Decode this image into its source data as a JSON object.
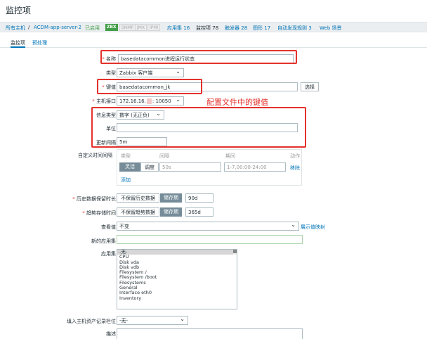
{
  "page": {
    "title": "监控项"
  },
  "subnav": {
    "all_hosts": "所有主机",
    "separator": "/",
    "host": "ACDM-app-server-2",
    "status": "已启用",
    "badges": [
      "ZBX",
      "SNMP",
      "JMX",
      "IPMI"
    ],
    "links": [
      {
        "label": "应用集",
        "count": "16"
      },
      {
        "label": "监控项",
        "count": "78"
      },
      {
        "label": "触发器",
        "count": "28"
      },
      {
        "label": "图形",
        "count": "17"
      },
      {
        "label": "自动发现规则",
        "count": "3"
      },
      {
        "label": "Web 场景",
        "count": ""
      }
    ]
  },
  "tabs": [
    "监控项",
    "预处理"
  ],
  "form": {
    "name": {
      "label": "名称",
      "value": "basedatacommon进程运行状态"
    },
    "type": {
      "label": "类型",
      "value": "Zabbix 客户端"
    },
    "key": {
      "label": "键值",
      "value": "basedatacommon_jk",
      "select_label": "选择"
    },
    "interface": {
      "label": "主机接口",
      "ip": "172.16.16.",
      "port": ": 10050"
    },
    "value_type": {
      "label": "信息类型",
      "value": "数字 (无正负)"
    },
    "units": {
      "label": "单位",
      "value": ""
    },
    "delay": {
      "label": "更新间隔",
      "value": "5m"
    },
    "custom_intervals": {
      "label": "自定义时间间隔",
      "headers": [
        "类型",
        "间隔",
        "期间",
        "动作"
      ],
      "row": {
        "flexible": "灵活",
        "scheduling": "调度",
        "interval": "50s",
        "period": "1-7,00:00-24:00",
        "remove": "移除"
      },
      "add": "添加"
    },
    "history": {
      "label": "历史数据保留时长",
      "opt_off": "不保留历史数据",
      "opt_on": "储存期",
      "value": "90d"
    },
    "trends": {
      "label": "趋势存储时间",
      "opt_off": "不保留趋势数据",
      "opt_on": "储存期",
      "value": "365d"
    },
    "valuemap": {
      "label": "查看值",
      "value": "不变",
      "link": "展示值映射"
    },
    "new_app": {
      "label": "新的应用集",
      "value": ""
    },
    "applications": {
      "label": "应用集",
      "items": [
        "-无-",
        "CPU",
        "Disk vda",
        "Disk vdb",
        "Filesystem /",
        "Filesystem /boot",
        "Filesystems",
        "General",
        "Interface eth0",
        "Inventory"
      ]
    },
    "inventory": {
      "label": "填入主机资产记录栏位",
      "value": "-无-"
    },
    "description": {
      "label": "描述",
      "value": ""
    }
  },
  "annotation": "配置文件中的键值",
  "colors": {
    "accent": "#0275b8",
    "highlight_box": "#e3322c",
    "enabled": "#429e47"
  }
}
